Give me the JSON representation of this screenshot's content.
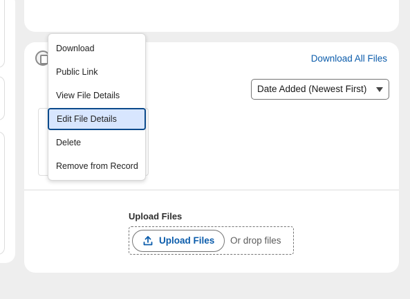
{
  "menu": {
    "items": [
      {
        "label": "Download"
      },
      {
        "label": "Public Link"
      },
      {
        "label": "View File Details"
      },
      {
        "label": "Edit File Details",
        "active": true
      },
      {
        "label": "Delete"
      },
      {
        "label": "Remove from Record"
      }
    ]
  },
  "files": {
    "download_all_label": "Download All Files",
    "sort_selected": "Date Added (Newest First)"
  },
  "upload": {
    "section_label": "Upload Files",
    "button_label": "Upload Files",
    "drop_text": "Or drop files"
  },
  "colors": {
    "link": "#0b5cab",
    "active_item_bg": "#d8e6fe",
    "active_item_border": "#0b4a8b"
  },
  "icons": [
    "files-icon",
    "caret-down-icon",
    "upload-icon"
  ]
}
